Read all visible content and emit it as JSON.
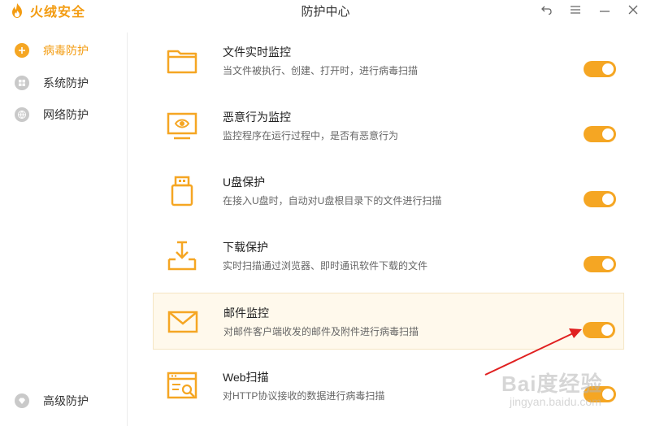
{
  "app": {
    "brand": "火绒安全",
    "window_title": "防护中心",
    "accent": "#f5a623"
  },
  "window_buttons": [
    {
      "name": "back-icon",
      "glyph": "↶"
    },
    {
      "name": "menu-icon",
      "glyph": "☰"
    },
    {
      "name": "minimize-icon",
      "glyph": "—"
    },
    {
      "name": "close-icon",
      "glyph": "✕"
    }
  ],
  "sidebar": {
    "items": [
      {
        "label": "病毒防护",
        "icon": "virus-shield-icon",
        "active": true
      },
      {
        "label": "系统防护",
        "icon": "windows-icon",
        "active": false
      },
      {
        "label": "网络防护",
        "icon": "globe-icon",
        "active": false
      }
    ],
    "bottom_item": {
      "label": "高级防护",
      "icon": "diamond-icon"
    }
  },
  "rows": [
    {
      "title": "文件实时监控",
      "desc": "当文件被执行、创建、打开时，进行病毒扫描",
      "icon": "folder-icon",
      "enabled": true
    },
    {
      "title": "恶意行为监控",
      "desc": "监控程序在运行过程中，是否有恶意行为",
      "icon": "monitor-eye-icon",
      "enabled": true
    },
    {
      "title": "U盘保护",
      "desc": "在接入U盘时，自动对U盘根目录下的文件进行扫描",
      "icon": "usb-icon",
      "enabled": true
    },
    {
      "title": "下载保护",
      "desc": "实时扫描通过浏览器、即时通讯软件下载的文件",
      "icon": "download-icon",
      "enabled": true
    },
    {
      "title": "邮件监控",
      "desc": "对邮件客户端收发的邮件及附件进行病毒扫描",
      "icon": "mail-icon",
      "enabled": true,
      "highlighted": true
    },
    {
      "title": "Web扫描",
      "desc": "对HTTP协议接收的数据进行病毒扫描",
      "icon": "web-scan-icon",
      "enabled": true
    }
  ],
  "watermark": {
    "main": "Bai度经验",
    "sub": "jingyan.baidu.com"
  }
}
